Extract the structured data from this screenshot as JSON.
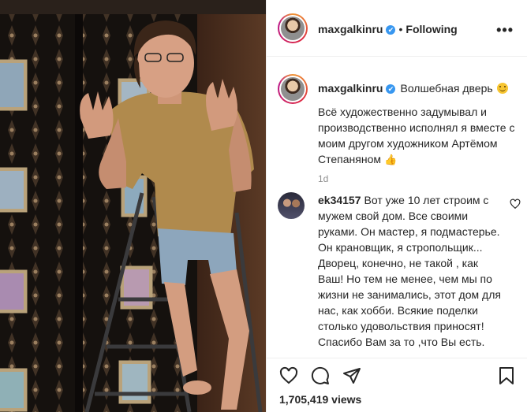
{
  "post": {
    "username": "maxgalkinru",
    "verified_glyph": "✔",
    "separator": "•",
    "follow_status": "Following",
    "more_glyph": "•••"
  },
  "caption": {
    "username": "maxgalkinru",
    "title": "Волшебная дверь",
    "title_emoji": "smiling-face-emoji",
    "body": "Всё художественно задумывал и производственно исполнял я вместе с моим другом художником Артёмом Степаняном",
    "body_emoji": "👍",
    "timestamp": "1d"
  },
  "comments": [
    {
      "username": "ek34157",
      "text": "Вот уже 10 лет строим с мужем свой дом. Все своими руками. Он мастер, я подмастерье. Он крановщик, я стропольщик... Дворец, конечно, не такой , как Ваш! Но тем не менее, чем мы по жизни не занимались, этот дом для нас, как хобби. Всякие поделки столько удовольствия приносят! Спасибо Вам за то ,что Вы есть."
    }
  ],
  "actions": {
    "icons": [
      "heart-icon",
      "comment-icon",
      "share-icon",
      "bookmark-icon"
    ],
    "views": "1,705,419 views"
  },
  "colors": {
    "accent": "#3897f0",
    "text": "#262626",
    "muted": "#8e8e8e",
    "border": "#efefef"
  }
}
